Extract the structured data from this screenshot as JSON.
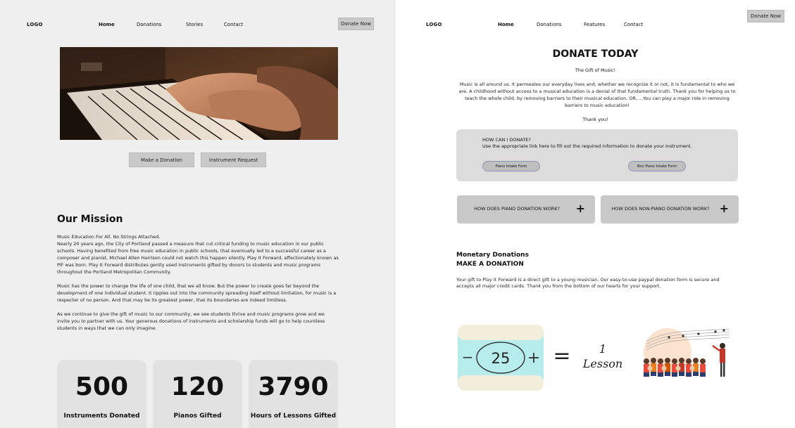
{
  "left": {
    "logo": "LOGO",
    "nav": [
      "Home",
      "Donations",
      "Stories",
      "Contact"
    ],
    "donate_now": "Donate Now",
    "buttons": {
      "make_donation": "Make a Donation",
      "instrument_request": "Instrument Request"
    },
    "mission": {
      "title": "Our Mission",
      "p1_lead": "Music Education For All.  No Strings Attached.",
      "p1": "Nearly 20 years ago, the City of Portland passed a measure that cut critical funding to music education in our public schools. Having benefited from free music education in public schools, that eventually led to a successful career as a composer and pianist, Michael Allen Harrison could not watch this happen silently. Play It Forward, affectionately known as PiF was born. Play It Forward distributes gently used instruments gifted by donors to students and music programs throughout the Portland Metropolitan Community.",
      "p2": "Music has the power to change the life of one child, that we all know.  But the power to create goes far beyond the development of one individual student. It ripples out into the community spreading itself without limitation, for music is a respecter of no person.   And that may be its greatest power, that its boundaries are indeed limitless.",
      "p3": "As we continue to give the gift of music to our community, we see students thrive and music programs grow and we invite you to partner with us.   Your generous donations of instruments and scholarship funds will go to help countless students in ways that we can only imagine."
    },
    "stats": [
      {
        "number": "500",
        "label": "Instruments Donated"
      },
      {
        "number": "120",
        "label": "Pianos Gifted"
      },
      {
        "number": "3790",
        "label": "Hours of Lessons Gifted"
      }
    ]
  },
  "right": {
    "logo": "LOGO",
    "nav": [
      "Home",
      "Donations",
      "Features",
      "Contact"
    ],
    "donate_now": "Donate Now",
    "title": "DONATE TODAY",
    "gift_line": "The Gift of Music!",
    "intro": "Music is all around us.  It permeates our everyday lives and, whether we recognize it or not, it is fundamental to who  we are. A childhood without access to a musical education is a denial of that fundamental truth. Thank you for helping us to teach the whole child, by removing barriers to their musical education. OR.....You can play a major role in removing barriers to music education!",
    "thanks": "Thank you!",
    "how": {
      "question": "HOW CAN I DONATE?",
      "instruction": "Use the appropriate link here to fill out the required information to donate your instrument.",
      "piano_form": "Piano Intake Form",
      "non_piano_form": "Non Piano Intake Form"
    },
    "accordions": [
      {
        "label": "HOW DOES PIANO DONATION WORK?",
        "icon": "+"
      },
      {
        "label": "HOW DOES NON-PIANO DONATION WORK?",
        "icon": "+"
      }
    ],
    "monetary": {
      "title": "Monetary Donations",
      "subtitle": "MAKE A DONATION",
      "text": "Your gift to Play It Forward is a direct gift to a young musician. Our easy-to-use paypal donation form is secure and accepts all major credit cards. Thank you from the bottom of our hearts for your support."
    },
    "lesson_graphic": {
      "amount": "25",
      "minus": "−",
      "plus": "+",
      "equals": "=",
      "count": "1",
      "unit": "Lesson"
    }
  },
  "colors": {
    "left_bg": "#eeefee",
    "card_bg": "#e2e2e2",
    "button_grey": "#c9c9c9",
    "pill_border": "#8e95b5",
    "ticket_cyan": "#b6ecec",
    "ticket_cream": "#f3eedb"
  }
}
